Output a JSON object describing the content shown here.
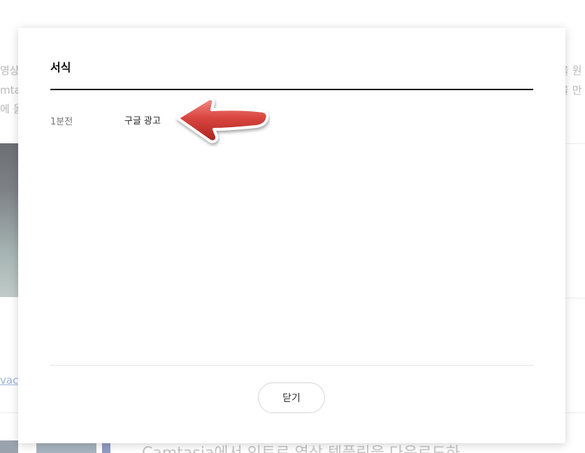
{
  "modal": {
    "title": "서식",
    "history": [
      {
        "time": "1분전",
        "text": "구글 광고"
      }
    ],
    "close_label": "닫기"
  },
  "background": {
    "left_fragments": [
      "영상",
      "mta",
      "에 올"
    ],
    "right_fragments": [
      "을 원",
      "을 만",
      ""
    ],
    "link_fragment": "vac",
    "bottom_title": "Camtasia에서 인트로 영상 템플릿을 다운로드하"
  },
  "annotation": {
    "icon": "red-arrow-icon",
    "color": "#d9453f"
  }
}
